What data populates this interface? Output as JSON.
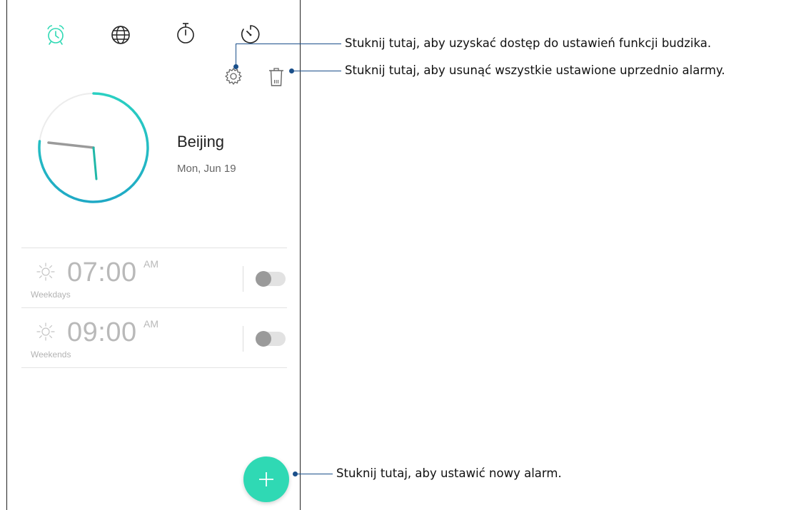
{
  "tabs": [
    {
      "name": "alarm-clock-icon",
      "active": true
    },
    {
      "name": "globe-icon",
      "active": false
    },
    {
      "name": "stopwatch-icon",
      "active": false
    },
    {
      "name": "timer-icon",
      "active": false
    }
  ],
  "colors": {
    "accent": "#2fd9b4",
    "clock_arc_start": "#2ad0c2",
    "clock_arc_end": "#1fa9c5",
    "callout_line": "#1a4f8a",
    "toggle_off_track": "#e2e2e2",
    "toggle_off_knob": "#9a9a9a"
  },
  "toolbar": {
    "settings_icon": "gear-icon",
    "delete_icon": "trash-icon"
  },
  "world_clock": {
    "city": "Beijing",
    "date": "Mon, Jun 19"
  },
  "alarms": [
    {
      "time": "07:00",
      "ampm": "AM",
      "repeat": "Weekdays",
      "enabled": false,
      "icon": "sun-icon"
    },
    {
      "time": "09:00",
      "ampm": "AM",
      "repeat": "Weekends",
      "enabled": false,
      "icon": "sun-icon"
    }
  ],
  "fab": {
    "icon": "plus-icon"
  },
  "callouts": {
    "settings": "Stuknij tutaj, aby uzyskać dostęp do ustawień funkcji budzika.",
    "delete_all": "Stuknij tutaj, aby usunąć wszystkie ustawione uprzednio alarmy.",
    "new_alarm": "Stuknij tutaj, aby ustawić nowy alarm."
  }
}
